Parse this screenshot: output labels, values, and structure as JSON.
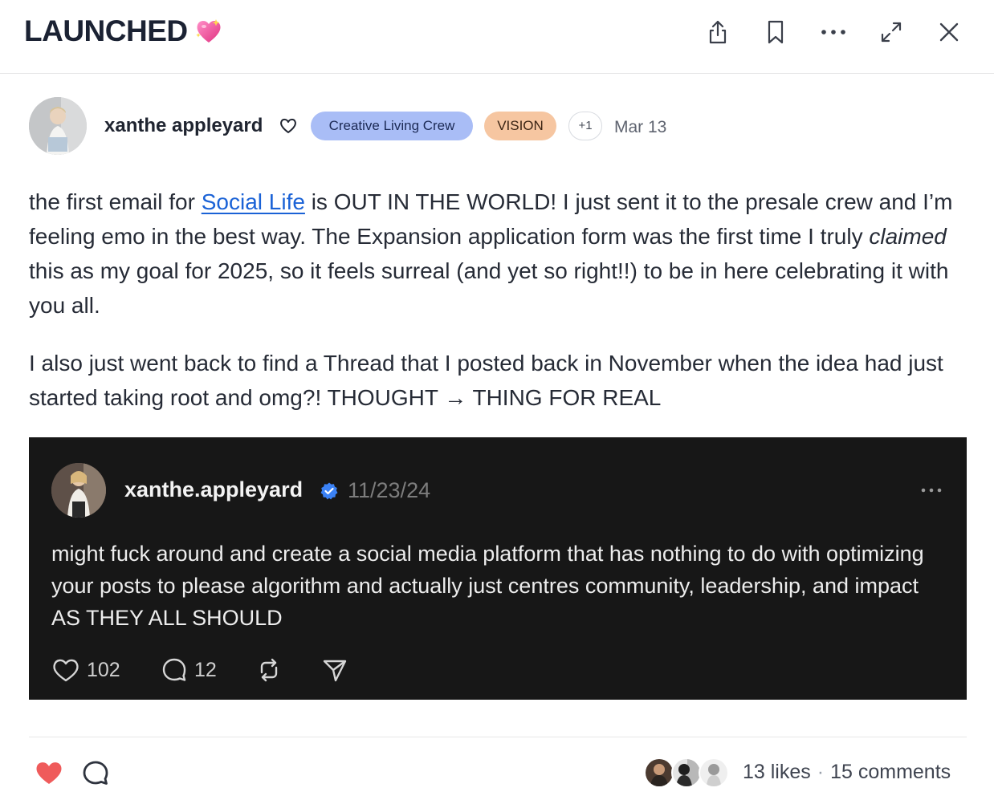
{
  "header": {
    "title": "LAUNCHED",
    "title_emoji_icon": "sparkling-heart-icon",
    "icons": [
      "share-icon",
      "bookmark-icon",
      "more-icon",
      "expand-icon",
      "close-icon"
    ]
  },
  "post": {
    "author": "xanthe appleyard",
    "badges": {
      "crew": "Creative Living Crew",
      "vision": "VISION",
      "more": "+1"
    },
    "date": "Mar 13",
    "paragraph1": {
      "before_link": "the first email for ",
      "link": "Social Life",
      "after_link": " is OUT IN THE WORLD! I just sent it to the presale crew and I’m feeling emo in the best way. The Expansion application form was the first time I truly ",
      "italic": "claimed",
      "after_italic": " this as my goal for 2025, so it feels surreal (and yet so right!!) to be in here celebrating it with you all."
    },
    "paragraph2": "I also just went back to find a Thread that I posted back in November when the idea had just started taking root and omg?! THOUGHT → THING FOR REAL"
  },
  "thread": {
    "username": "xanthe.appleyard",
    "date": "11/23/24",
    "text": "might fuck around and create a social media platform that has nothing to do with optimizing your posts to please algorithm and actually just centres community, leadership, and impact AS THEY ALL SHOULD",
    "likes": "102",
    "replies": "12"
  },
  "footer": {
    "likes": "13 likes",
    "separator": "·",
    "comments": "15 comments"
  },
  "colors": {
    "crew_badge": "#a9bdf6",
    "vision_badge": "#f6c6a1",
    "link": "#1a62d6",
    "like_heart": "#ef5b5b",
    "thread_bg": "#171717",
    "verified": "#3b82f6"
  }
}
